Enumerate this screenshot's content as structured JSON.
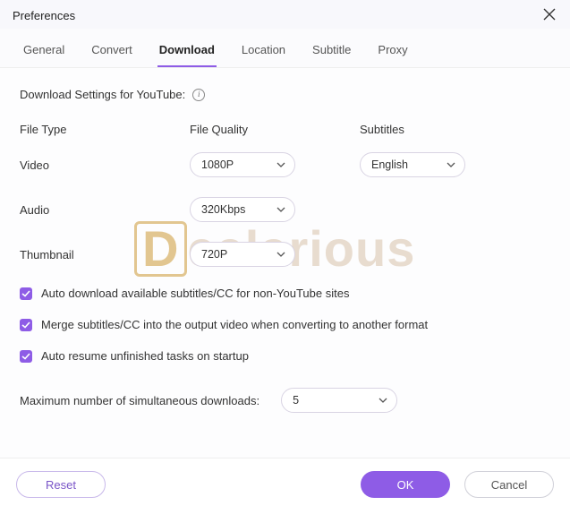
{
  "window": {
    "title": "Preferences"
  },
  "tabs": {
    "general": "General",
    "convert": "Convert",
    "download": "Download",
    "location": "Location",
    "subtitle": "Subtitle",
    "proxy": "Proxy",
    "active": "download"
  },
  "section": {
    "title": "Download Settings for YouTube:"
  },
  "columns": {
    "file_type": "File Type",
    "file_quality": "File Quality",
    "subtitles": "Subtitles"
  },
  "rows": {
    "video": {
      "label": "Video",
      "quality": "1080P",
      "subtitles": "English"
    },
    "audio": {
      "label": "Audio",
      "quality": "320Kbps"
    },
    "thumbnail": {
      "label": "Thumbnail",
      "quality": "720P"
    }
  },
  "checkboxes": {
    "auto_download_subs": "Auto download available subtitles/CC for non-YouTube sites",
    "merge_subs": "Merge subtitles/CC into the output video when converting to another format",
    "auto_resume": "Auto resume unfinished tasks on startup"
  },
  "max_downloads": {
    "label": "Maximum number of simultaneous downloads:",
    "value": "5"
  },
  "buttons": {
    "reset": "Reset",
    "ok": "OK",
    "cancel": "Cancel"
  },
  "watermark": {
    "rest": "ealarious"
  }
}
